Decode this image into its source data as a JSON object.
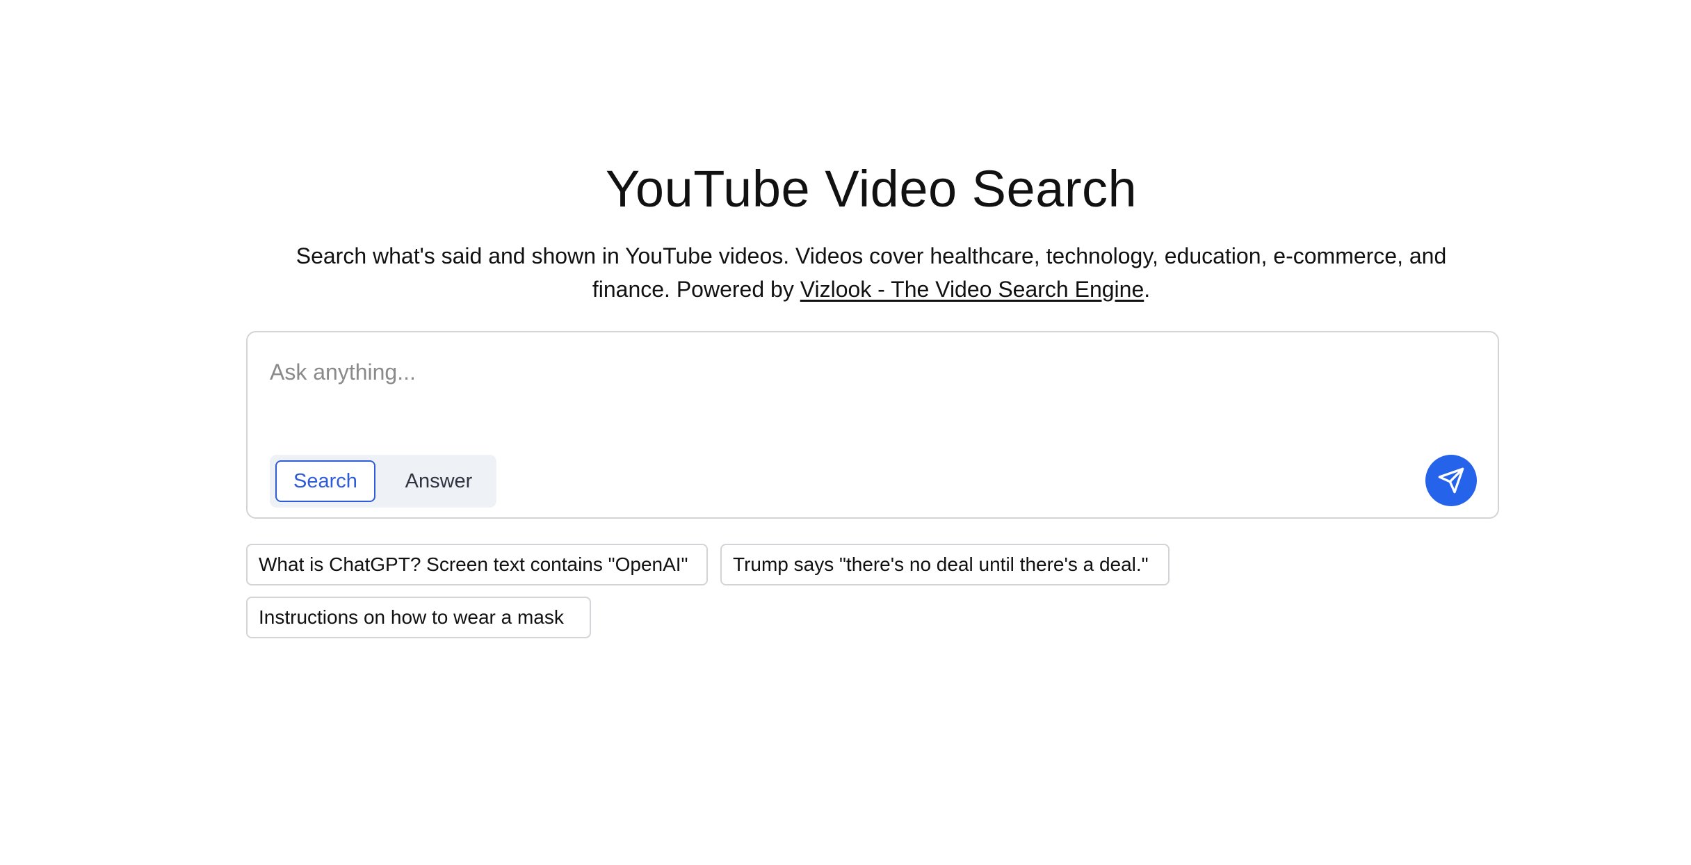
{
  "header": {
    "title": "YouTube Video Search",
    "subtitle_text": "Search what's said and shown in YouTube videos. Videos cover healthcare, technology, education, e-commerce, and finance. Powered by ",
    "subtitle_link": "Vizlook - The Video Search Engine",
    "subtitle_end": "."
  },
  "search": {
    "placeholder": "Ask anything...",
    "value": "",
    "modes": [
      "Search",
      "Answer"
    ],
    "selected_mode": "Search",
    "send_icon": "send-icon"
  },
  "suggestions": [
    "What is ChatGPT? Screen text contains \"OpenAI\"",
    "Trump says \"there's no deal until there's a deal.\"",
    "Instructions on how to wear a mask"
  ],
  "colors": {
    "accent": "#2563eb",
    "selected_mode": "#2e5bd8",
    "toggle_background": "#eef2f7",
    "border": "#d4d4d8"
  }
}
